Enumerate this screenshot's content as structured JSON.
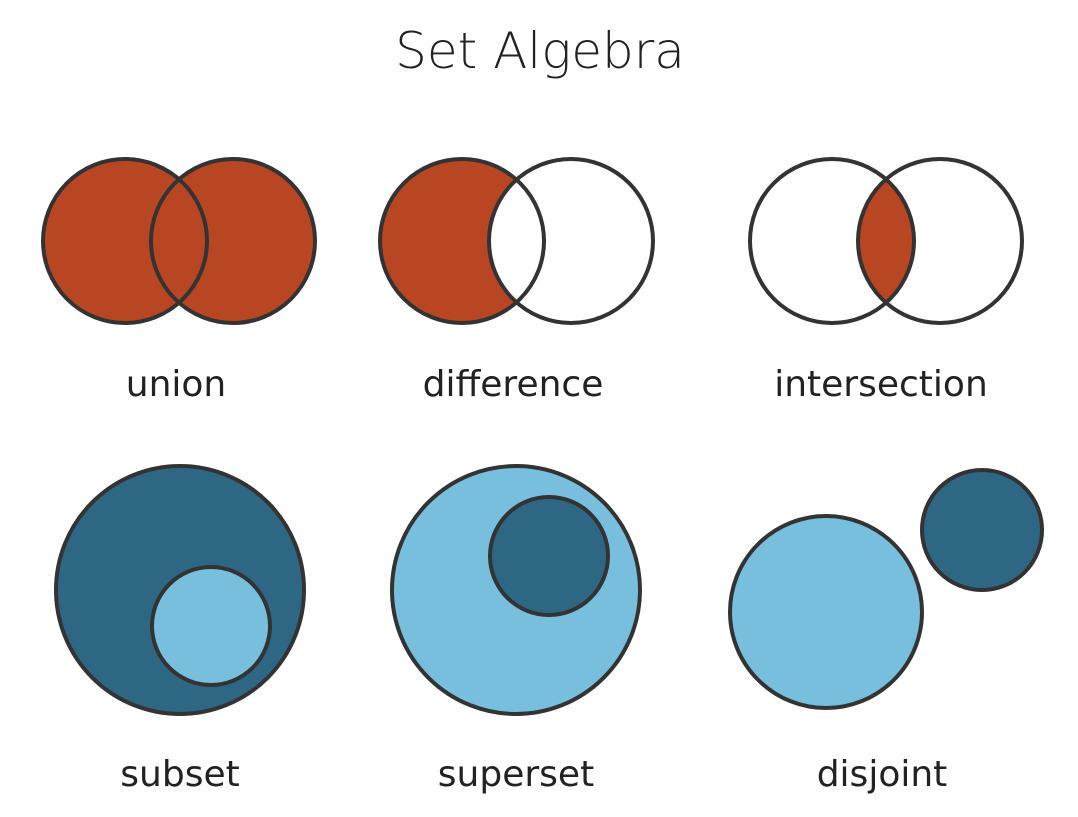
{
  "title": "Set Algebra",
  "colors": {
    "highlight": "#B94622",
    "dark_set": "#2E6784",
    "light_set": "#77BFDC",
    "outline": "#333333",
    "empty": "#FFFFFF"
  },
  "diagrams": [
    {
      "label": "union"
    },
    {
      "label": "difference"
    },
    {
      "label": "intersection"
    },
    {
      "label": "subset"
    },
    {
      "label": "superset"
    },
    {
      "label": "disjoint"
    }
  ]
}
